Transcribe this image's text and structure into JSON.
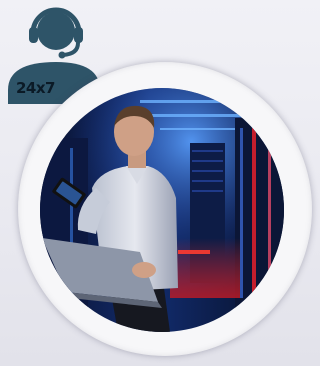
{
  "badge": {
    "label": "24x7",
    "icon": "headset-support-icon",
    "color": "#2e5468"
  },
  "photo": {
    "icon": "datacenter-engineer-photo",
    "colors": {
      "corridor": "#0a1a4a",
      "accent_red": "#d81f2c",
      "light_blue": "#3f8cff"
    }
  }
}
